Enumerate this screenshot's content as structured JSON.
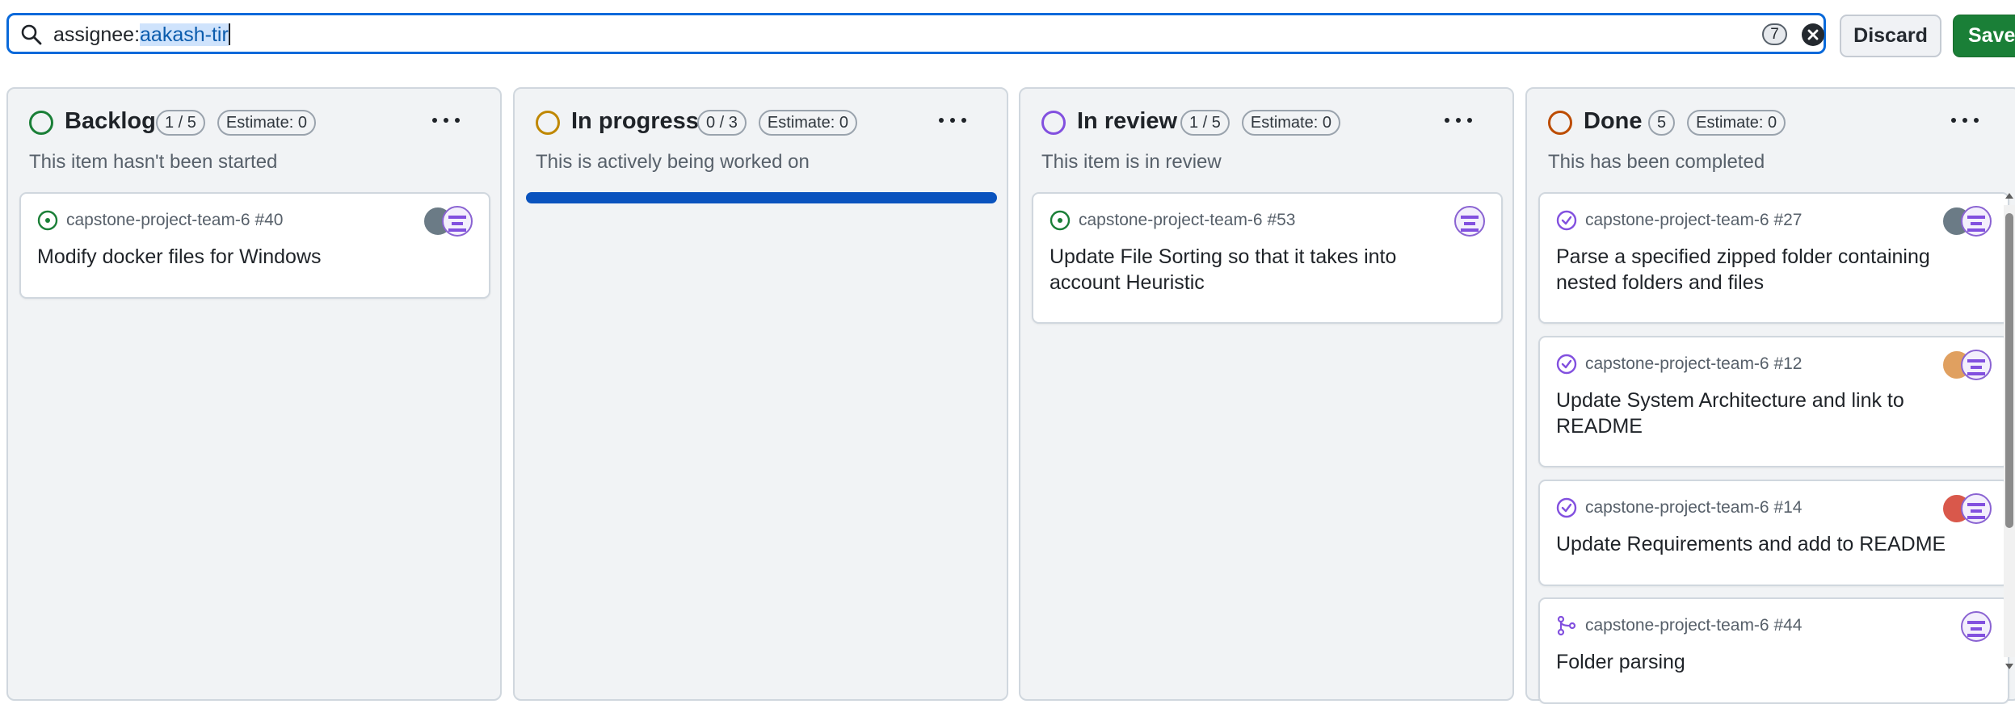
{
  "filter": {
    "prefix": "assignee:",
    "selected": "aakash-tir",
    "count": "7"
  },
  "buttons": {
    "discard": "Discard",
    "save": "Save"
  },
  "colors": {
    "accent": "#0969da",
    "save_green": "#1a7f37",
    "backlog": "#1a7f37",
    "in_progress": "#bf8700",
    "in_review": "#8250df",
    "done": "#bc4c00"
  },
  "columns": [
    {
      "title": "Backlog",
      "count": "1 / 5",
      "estimate": "Estimate: 0",
      "description": "This item hasn't been started",
      "cards": [
        {
          "repo": "capstone-project-team-6 #40",
          "title": "Modify docker files for Windows",
          "state_icon": "open-issue-icon"
        }
      ]
    },
    {
      "title": "In progress",
      "count": "0 / 3",
      "estimate": "Estimate: 0",
      "description": "This is actively being worked on",
      "cards": []
    },
    {
      "title": "In review",
      "count": "1 / 5",
      "estimate": "Estimate: 0",
      "description": "This item is in review",
      "cards": [
        {
          "repo": "capstone-project-team-6 #53",
          "title": "Update File Sorting so that it takes into account Heuristic",
          "state_icon": "open-issue-icon"
        }
      ]
    },
    {
      "title": "Done",
      "count": "5",
      "estimate": "Estimate: 0",
      "description": "This has been completed",
      "cards": [
        {
          "repo": "capstone-project-team-6 #27",
          "title": "Parse a specified zipped folder containing nested folders and files",
          "state_icon": "closed-issue-icon"
        },
        {
          "repo": "capstone-project-team-6 #12",
          "title": "Update System Architecture and link to README",
          "state_icon": "closed-issue-icon"
        },
        {
          "repo": "capstone-project-team-6 #14",
          "title": "Update Requirements and add to README",
          "state_icon": "closed-issue-icon"
        },
        {
          "repo": "capstone-project-team-6 #44",
          "title": "Folder parsing",
          "state_icon": "merged-pr-icon"
        }
      ]
    }
  ]
}
